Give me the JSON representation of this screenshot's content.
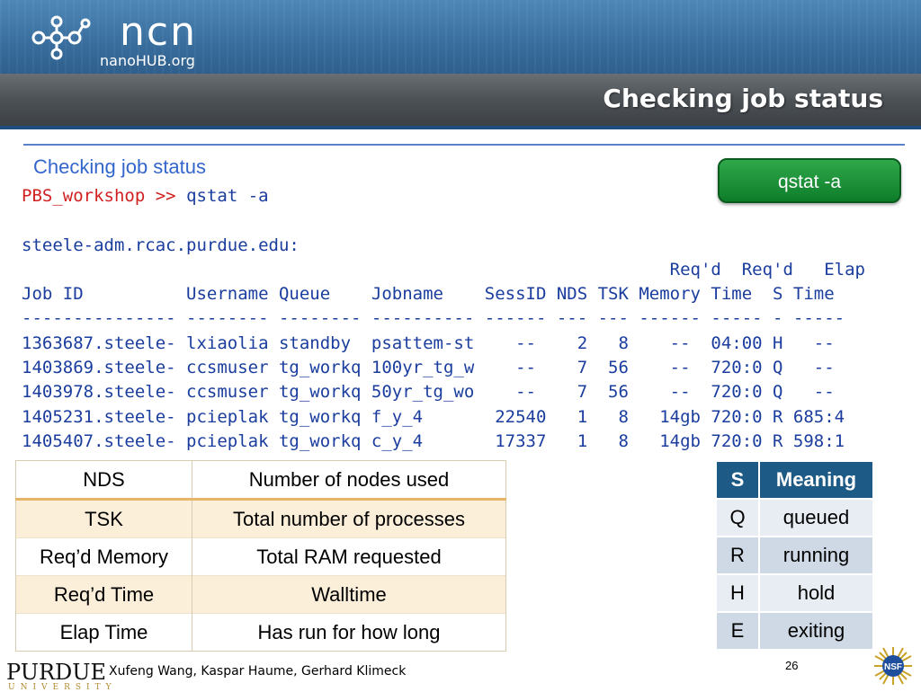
{
  "header": {
    "logo_main": "NCN",
    "logo_sub": "nanoHUB.org",
    "title": "Checking job status"
  },
  "subtitle": "Checking job status",
  "command_button": {
    "label": "qstat -a"
  },
  "terminal": {
    "prompt": "PBS_workshop",
    "arrow": ">>",
    "command": "qstat -a",
    "host": "steele-adm.rcac.purdue.edu:",
    "header1": "                                                               Req'd  Req'd   Elap",
    "header2": "Job ID          Username Queue    Jobname    SessID NDS TSK Memory Time  S Time",
    "separator": "--------------- -------- -------- ---------- ------ --- --- ------ ----- - -----",
    "rows": [
      "1363687.steele- lxiaolia standby  psattem-st    --    2   8    --  04:00 H   --",
      "1403869.steele- ccsmuser tg_workq 100yr_tg_w    --    7  56    --  720:0 Q   --",
      "1403978.steele- ccsmuser tg_workq 50yr_tg_wo    --    7  56    --  720:0 Q   --",
      "1405231.steele- pcieplak tg_workq f_y_4       22540   1   8   14gb 720:0 R 685:4",
      "1405407.steele- pcieplak tg_workq c_y_4       17337   1   8   14gb 720:0 R 598:1"
    ]
  },
  "glossary": [
    {
      "term": "NDS",
      "definition": "Number of nodes used"
    },
    {
      "term": "TSK",
      "definition": "Total number of processes"
    },
    {
      "term": "Req’d Memory",
      "definition": "Total RAM requested"
    },
    {
      "term": "Req’d Time",
      "definition": "Walltime"
    },
    {
      "term": "Elap Time",
      "definition": "Has run for how long"
    }
  ],
  "status_table": {
    "col_s": "S",
    "col_meaning": "Meaning",
    "rows": [
      {
        "s": "Q",
        "meaning": "queued"
      },
      {
        "s": "R",
        "meaning": "running"
      },
      {
        "s": "H",
        "meaning": "hold"
      },
      {
        "s": "E",
        "meaning": "exiting"
      }
    ]
  },
  "footer": {
    "university_name": "PURDUE",
    "university_sub": "UNIVERSITY",
    "authors": "Xufeng Wang, Kaspar Haume, Gerhard Klimeck",
    "page_number": "26",
    "nsf_label": "NSF"
  },
  "colors": {
    "title_blue": "#3366cc",
    "terminal_blue": "#1a3d9e",
    "prompt_red": "#d11f1f",
    "button_green": "#0e7d2a",
    "table_header": "#1e5a86"
  }
}
